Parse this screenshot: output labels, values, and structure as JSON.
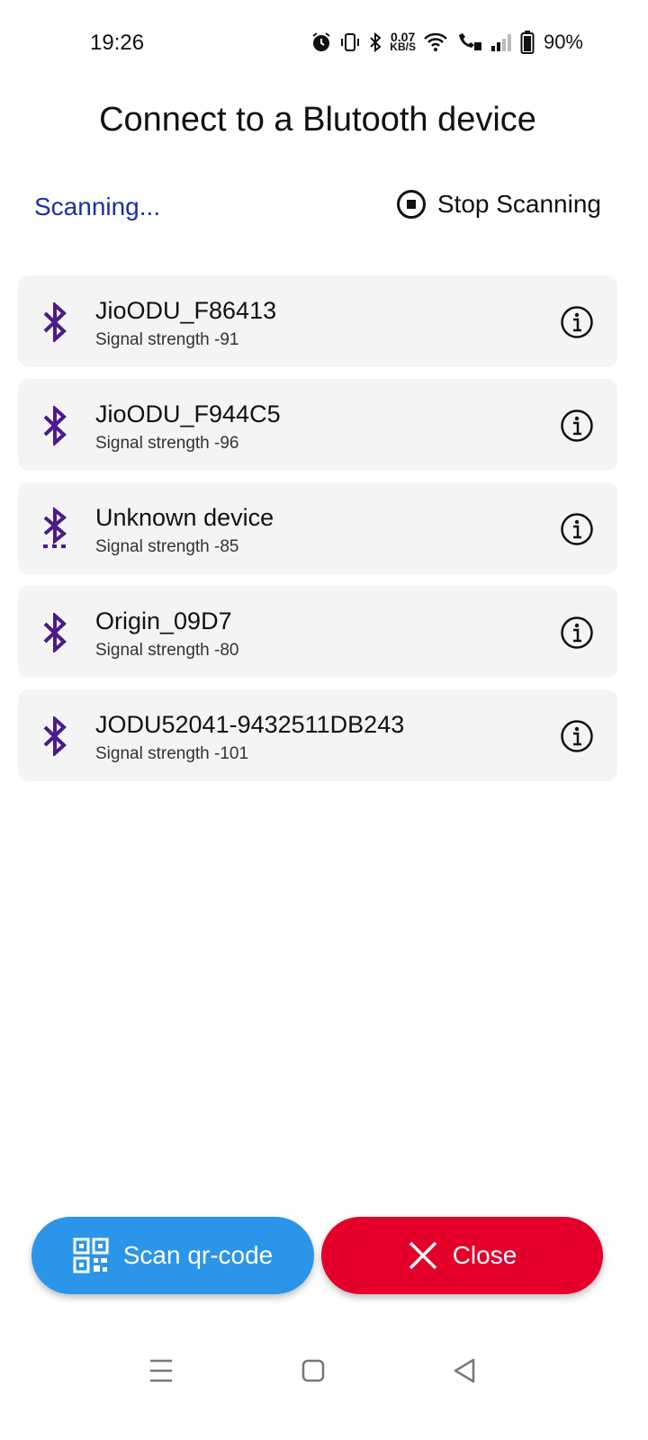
{
  "status_bar": {
    "time": "19:26",
    "net_speed_value": "0.07",
    "net_speed_unit": "KB/S",
    "battery": "90%"
  },
  "title": "Connect to a Blutooth device",
  "scan": {
    "status": "Scanning...",
    "stop_label": "Stop Scanning"
  },
  "devices": [
    {
      "name": "JioODU_F86413",
      "signal": "Signal strength -91",
      "icon": "bluetooth-icon"
    },
    {
      "name": "JioODU_F944C5",
      "signal": "Signal strength -96",
      "icon": "bluetooth-icon"
    },
    {
      "name": "Unknown device",
      "signal": "Signal strength -85",
      "icon": "bluetooth-searching-icon"
    },
    {
      "name": "Origin_09D7",
      "signal": "Signal strength -80",
      "icon": "bluetooth-icon"
    },
    {
      "name": "JODU52041-9432511DB243",
      "signal": "Signal strength -101",
      "icon": "bluetooth-icon"
    }
  ],
  "buttons": {
    "scan_qr": "Scan qr-code",
    "close": "Close"
  },
  "colors": {
    "scanning_text": "#1a2fa8",
    "bluetooth_icon": "#4b1a8c",
    "scan_qr_button": "#2b95e9",
    "close_button": "#e3002b",
    "card_background": "#f4f4f4"
  }
}
